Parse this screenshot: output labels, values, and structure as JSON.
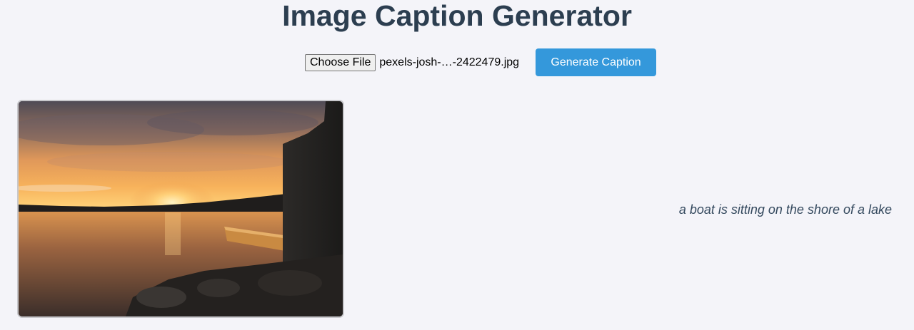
{
  "header": {
    "title": "Image Caption Generator"
  },
  "upload": {
    "choose_file_label": "Choose File",
    "file_name": "pexels-josh-…-2422479.jpg"
  },
  "actions": {
    "generate_label": "Generate Caption"
  },
  "result": {
    "caption": "a boat is sitting on the shore of a lake"
  },
  "colors": {
    "background": "#f4f4f9",
    "title": "#2c3e50",
    "button": "#3498db",
    "caption": "#34495e"
  }
}
